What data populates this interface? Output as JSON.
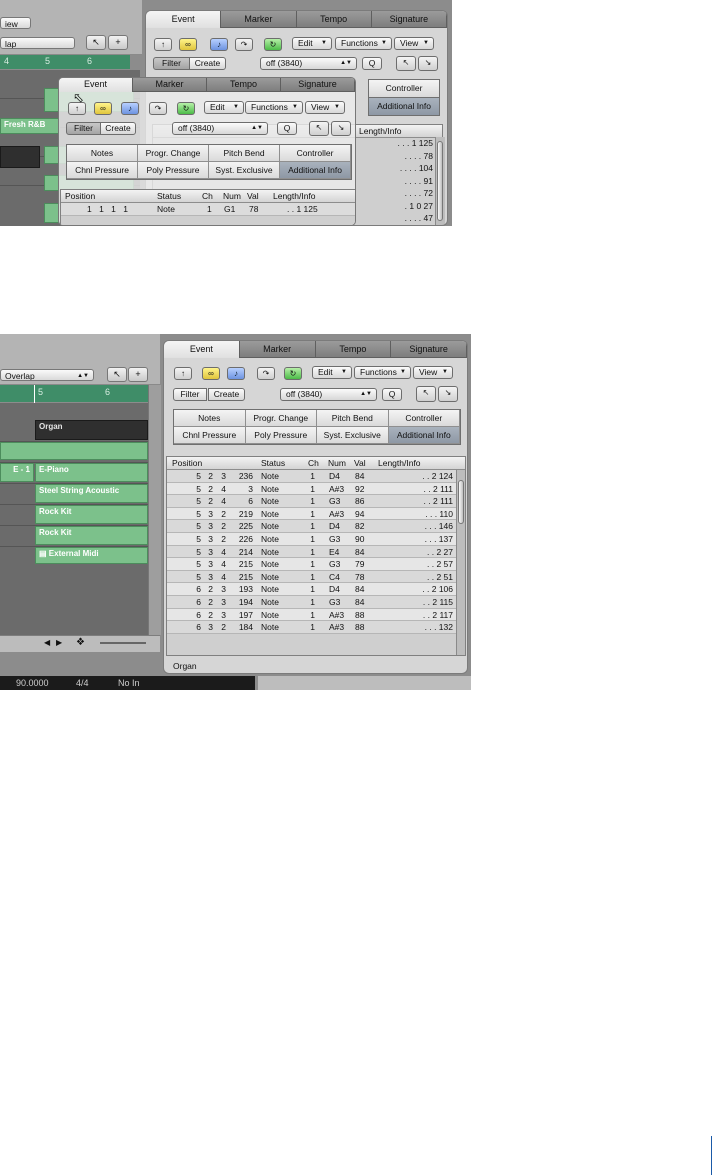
{
  "screenshot_top": {
    "arrange": {
      "view_menu": "iew",
      "drag_menu": "lap",
      "ruler": [
        "4",
        "5",
        "6"
      ],
      "regions": [
        "Fresh R&B"
      ]
    },
    "panel": {
      "tabs": [
        "Event",
        "Marker",
        "Tempo",
        "Signature"
      ],
      "menus": [
        "Edit",
        "Functions",
        "View"
      ],
      "filter_label": "Filter",
      "create_label": "Create",
      "quantize_value": "off (3840)",
      "q_label": "Q",
      "categories": [
        "Controller",
        "Additional Info"
      ],
      "list_header_label": "Length/Info",
      "length_col": [
        ". . . 1 125",
        ". . . . 78",
        ". . . . 104",
        ". . . . 91",
        ". . . . 72",
        ". 1 0 27",
        ". . . . 47"
      ]
    },
    "floating_window": {
      "tabs": [
        "Event",
        "Marker",
        "Tempo",
        "Signature"
      ],
      "menus": [
        "Edit",
        "Functions",
        "View"
      ],
      "filter_label": "Filter",
      "create_label": "Create",
      "quantize_value": "off (3840)",
      "q_label": "Q",
      "categories": [
        "Notes",
        "Progr. Change",
        "Pitch Bend",
        "Controller",
        "Chnl Pressure",
        "Poly Pressure",
        "Syst. Exclusive",
        "Additional Info"
      ],
      "headers": [
        "Position",
        "Status",
        "Ch",
        "Num",
        "Val",
        "Length/Info"
      ],
      "row": {
        "position": "1 1 1 1",
        "status": "Note",
        "ch": "1",
        "num": "G1",
        "val": "78",
        "length": ". . 1 125"
      }
    }
  },
  "screenshot_bottom": {
    "arrange": {
      "drag_menu": "Overlap",
      "ruler": [
        "5",
        "6"
      ],
      "regions": [
        "Organ",
        "E-Piano",
        "Steel String Acoustic",
        "Rock Kit",
        "Rock Kit",
        "External Midi"
      ],
      "track_label": "E - 1"
    },
    "panel": {
      "tabs": [
        "Event",
        "Marker",
        "Tempo",
        "Signature"
      ],
      "menus": [
        "Edit",
        "Functions",
        "View"
      ],
      "filter_label": "Filter",
      "create_label": "Create",
      "quantize_value": "off (3840)",
      "q_label": "Q",
      "categories": [
        "Notes",
        "Progr. Change",
        "Pitch Bend",
        "Controller",
        "Chnl Pressure",
        "Poly Pressure",
        "Syst. Exclusive",
        "Additional Info"
      ],
      "headers": [
        "Position",
        "Status",
        "Ch",
        "Num",
        "Val",
        "Length/Info"
      ],
      "rows": [
        {
          "bar": "5",
          "beat": "2",
          "div": "3",
          "tick": "236",
          "status": "Note",
          "ch": "1",
          "num": "D4",
          "val": "84",
          "length": ". . 2 124"
        },
        {
          "bar": "5",
          "beat": "2",
          "div": "4",
          "tick": "3",
          "status": "Note",
          "ch": "1",
          "num": "A#3",
          "val": "92",
          "length": ". . 2 111"
        },
        {
          "bar": "5",
          "beat": "2",
          "div": "4",
          "tick": "6",
          "status": "Note",
          "ch": "1",
          "num": "G3",
          "val": "86",
          "length": ". . 2 111"
        },
        {
          "bar": "5",
          "beat": "3",
          "div": "2",
          "tick": "219",
          "status": "Note",
          "ch": "1",
          "num": "A#3",
          "val": "94",
          "length": ". . . 110"
        },
        {
          "bar": "5",
          "beat": "3",
          "div": "2",
          "tick": "225",
          "status": "Note",
          "ch": "1",
          "num": "D4",
          "val": "82",
          "length": ". . . 146"
        },
        {
          "bar": "5",
          "beat": "3",
          "div": "2",
          "tick": "226",
          "status": "Note",
          "ch": "1",
          "num": "G3",
          "val": "90",
          "length": ". . . 137"
        },
        {
          "bar": "5",
          "beat": "3",
          "div": "4",
          "tick": "214",
          "status": "Note",
          "ch": "1",
          "num": "E4",
          "val": "84",
          "length": ". . 2 27"
        },
        {
          "bar": "5",
          "beat": "3",
          "div": "4",
          "tick": "215",
          "status": "Note",
          "ch": "1",
          "num": "G3",
          "val": "79",
          "length": ". . 2 57"
        },
        {
          "bar": "5",
          "beat": "3",
          "div": "4",
          "tick": "215",
          "status": "Note",
          "ch": "1",
          "num": "C4",
          "val": "78",
          "length": ". . 2 51"
        },
        {
          "bar": "6",
          "beat": "2",
          "div": "3",
          "tick": "193",
          "status": "Note",
          "ch": "1",
          "num": "D4",
          "val": "84",
          "length": ". . 2 106"
        },
        {
          "bar": "6",
          "beat": "2",
          "div": "3",
          "tick": "194",
          "status": "Note",
          "ch": "1",
          "num": "G3",
          "val": "84",
          "length": ". . 2 115"
        },
        {
          "bar": "6",
          "beat": "2",
          "div": "3",
          "tick": "197",
          "status": "Note",
          "ch": "1",
          "num": "A#3",
          "val": "88",
          "length": ". . 2 117"
        },
        {
          "bar": "6",
          "beat": "3",
          "div": "2",
          "tick": "184",
          "status": "Note",
          "ch": "1",
          "num": "A#3",
          "val": "88",
          "length": ". . . 132"
        }
      ],
      "status_text": "Organ"
    },
    "transport": {
      "tempo": "90.0000",
      "signature": "4/4",
      "input": "No In"
    }
  },
  "colors": {
    "accent_green": "#7cc18b",
    "selected_category": "#9aa4b0",
    "panel_bg": "#d6d6d6"
  }
}
